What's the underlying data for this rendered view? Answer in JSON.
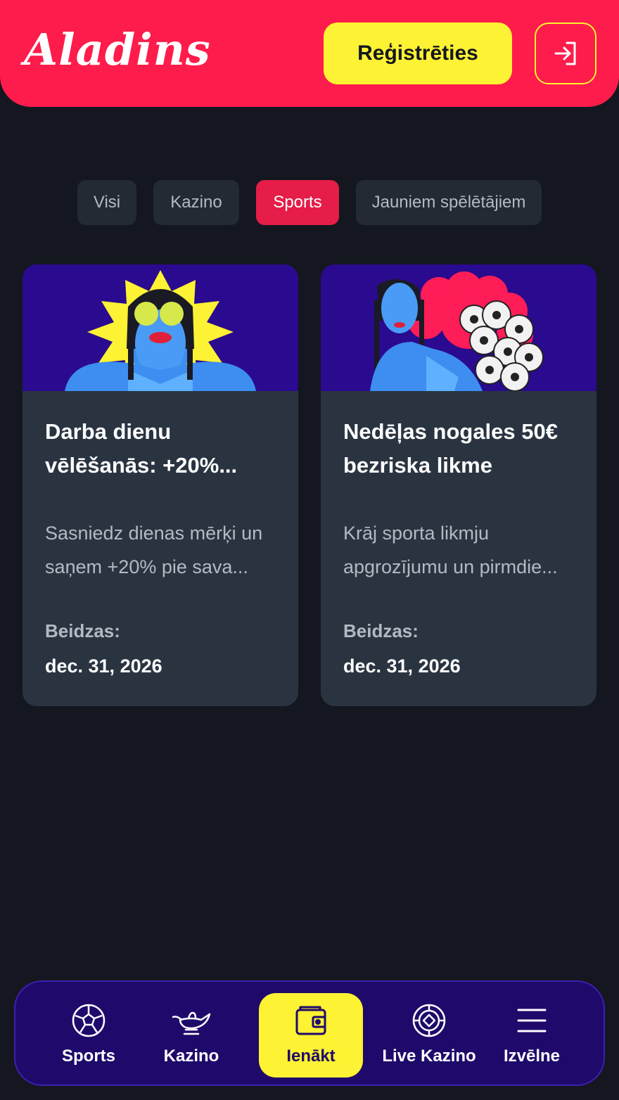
{
  "header": {
    "logo_text": "Aladins",
    "register_label": "Reģistrēties",
    "login_icon": "login-arrow-icon"
  },
  "filters": [
    {
      "label": "Visi",
      "active": false
    },
    {
      "label": "Kazino",
      "active": false
    },
    {
      "label": "Sports",
      "active": true
    },
    {
      "label": "Jauniem spēlētājiem",
      "active": false
    }
  ],
  "promotions": [
    {
      "title": "Darba dienu vēlēšanās: +20%...",
      "description": "Sasniedz dienas mērķi un saņem +20% pie sava...",
      "ends_label": "Beidzas:",
      "ends_date": "dec. 31, 2026"
    },
    {
      "title": "Nedēļas nogales 50€ bezriska likme",
      "description": "Krāj sporta likmju apgrozījumu un pirmdie...",
      "ends_label": "Beidzas:",
      "ends_date": "dec. 31, 2026"
    }
  ],
  "bottom_nav": [
    {
      "label": "Sports",
      "icon": "soccer-ball-icon",
      "active": false
    },
    {
      "label": "Kazino",
      "icon": "magic-lamp-icon",
      "active": false
    },
    {
      "label": "Ienākt",
      "icon": "wallet-icon",
      "active": true
    },
    {
      "label": "Live Kazino",
      "icon": "casino-chip-icon",
      "active": false
    },
    {
      "label": "Izvēlne",
      "icon": "menu-icon",
      "active": false
    }
  ],
  "colors": {
    "brand_red": "#fd1c4b",
    "accent_yellow": "#fdf233",
    "background": "#14171f",
    "card": "#2a3441",
    "nav_purple": "#1f0a6b"
  }
}
